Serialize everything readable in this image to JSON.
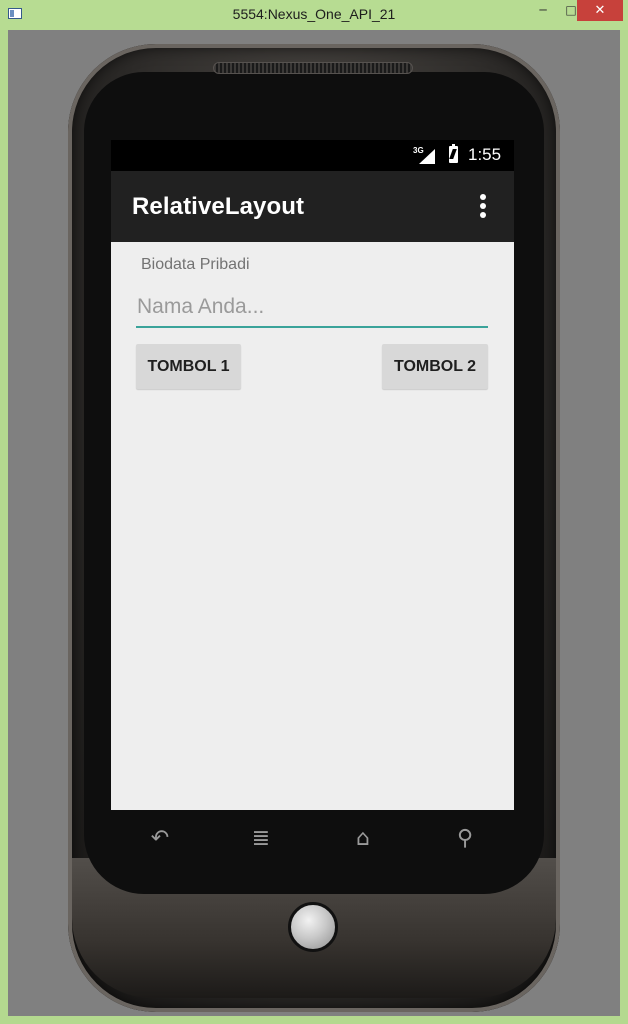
{
  "window": {
    "title": "5554:Nexus_One_API_21",
    "minimize_glyph": "─",
    "maximize_glyph": "□",
    "close_glyph": "✕"
  },
  "status_bar": {
    "network_label": "3G",
    "time": "1:55",
    "icons": [
      "signal-icon",
      "battery-icon"
    ]
  },
  "app_bar": {
    "title": "RelativeLayout",
    "overflow_icon": "overflow-menu-icon"
  },
  "form": {
    "label": "Biodata Pribadi",
    "name_placeholder": "Nama Anda...",
    "name_value": "",
    "button_1": "TOMBOL 1",
    "button_2": "TOMBOL 2"
  },
  "softkeys": {
    "back_glyph": "↶",
    "menu_glyph": "≣",
    "home_glyph": "⌂",
    "search_glyph": "⚲",
    "icons": [
      "back-icon",
      "menu-icon",
      "home-icon",
      "search-icon"
    ]
  },
  "colors": {
    "accent": "#3aa39a",
    "app_bar": "#212121",
    "status_bar": "#000000",
    "screen_bg": "#eeeeee",
    "button_bg": "#d8d8d8"
  }
}
